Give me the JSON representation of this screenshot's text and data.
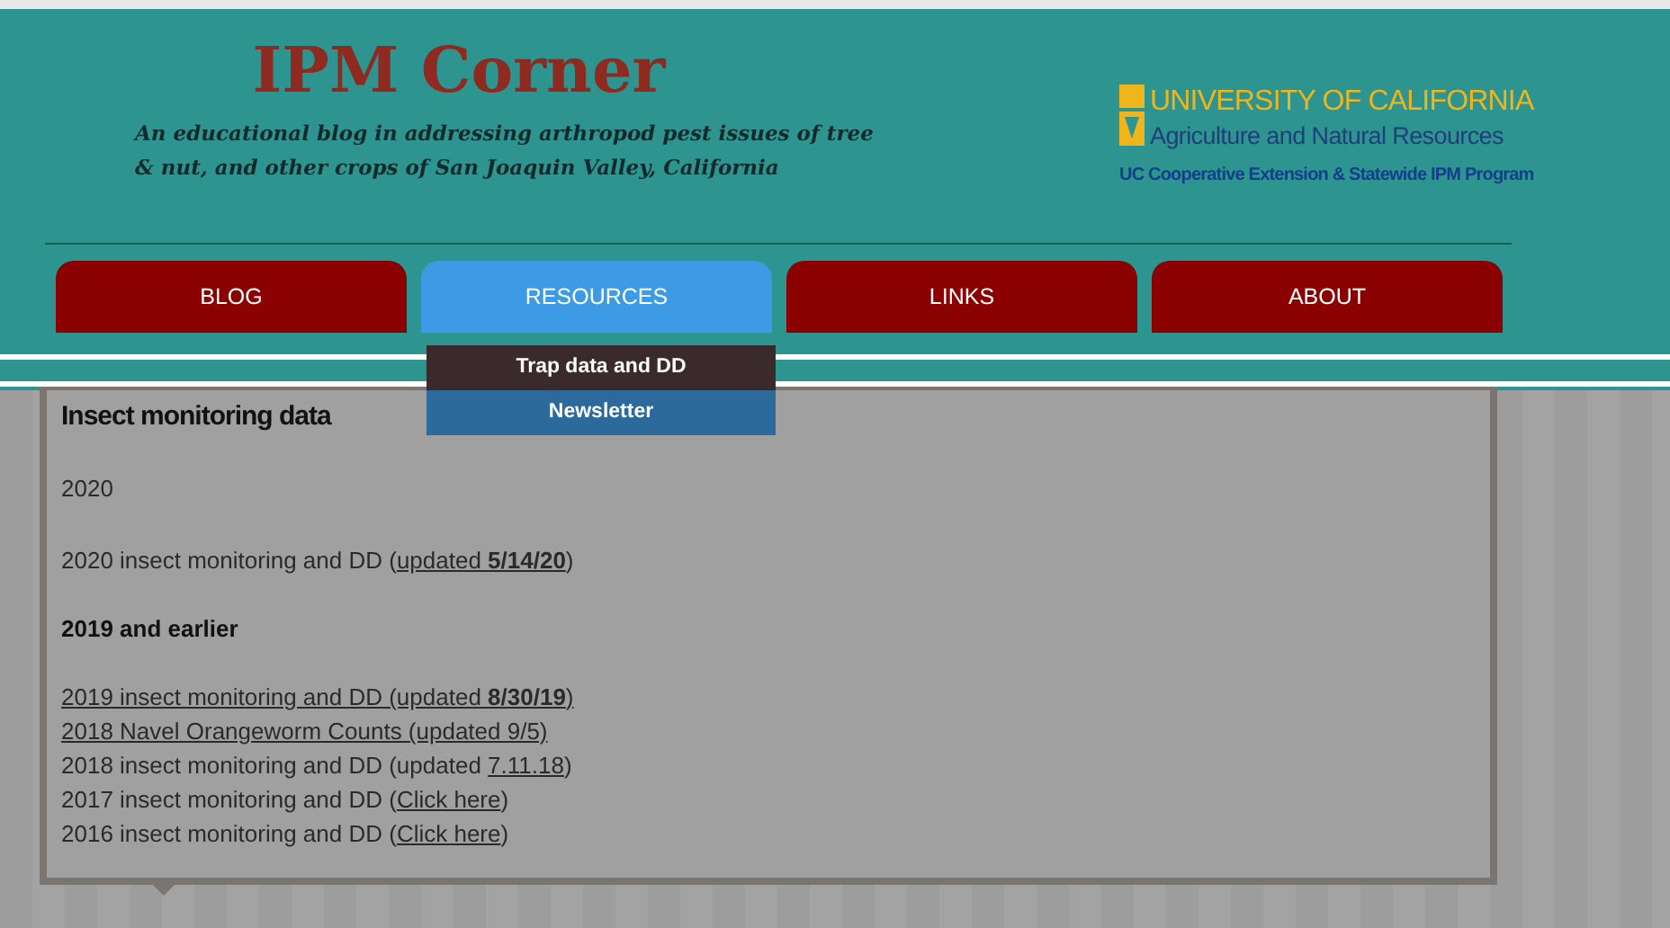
{
  "header": {
    "title": "IPM Corner",
    "tagline": "An educational blog in addressing arthropod pest issues of tree & nut, and other crops of San Joaquin Valley, California",
    "logo": {
      "name": "UNIVERSITY OF CALIFORNIA",
      "division": "Agriculture and Natural Resources",
      "program": "UC Cooperative Extension & Statewide IPM Program"
    }
  },
  "tabs": [
    {
      "label": "BLOG",
      "selected": false
    },
    {
      "label": "RESOURCES",
      "selected": true,
      "menu": [
        {
          "label": "Trap data and DD",
          "selected": true
        },
        {
          "label": "Newsletter",
          "selected": false
        }
      ]
    },
    {
      "label": "LINKS",
      "selected": false
    },
    {
      "label": "ABOUT",
      "selected": false
    }
  ],
  "content": {
    "heading": "Insect monitoring data",
    "blocks": [
      {
        "kind": "para",
        "lines": [
          [
            {
              "kind": "text",
              "text": "2020"
            }
          ]
        ]
      },
      {
        "kind": "para",
        "lines": [
          [
            {
              "kind": "text",
              "text": "2020 insect monitoring and DD ("
            },
            {
              "kind": "link",
              "text": "updated **5/14/20**"
            },
            {
              "kind": "text",
              "text": ")"
            }
          ]
        ]
      },
      {
        "kind": "subhead",
        "text": "2019 and earlier"
      },
      {
        "kind": "para",
        "lines": [
          [
            {
              "kind": "link",
              "text": "2019 insect monitoring and DD (updated **8/30/19**)"
            }
          ],
          [
            {
              "kind": "link",
              "text": "2018 Navel Orangeworm Counts (updated 9/5)"
            }
          ],
          [
            {
              "kind": "text",
              "text": "2018 insect monitoring and DD (updated "
            },
            {
              "kind": "link",
              "text": "7.11.18"
            },
            {
              "kind": "text",
              "text": ")"
            }
          ],
          [
            {
              "kind": "text",
              "text": "2017 insect monitoring and DD ("
            },
            {
              "kind": "link",
              "text": "Click here"
            },
            {
              "kind": "text",
              "text": ")"
            }
          ],
          [
            {
              "kind": "text",
              "text": "2016 insect monitoring and DD ("
            },
            {
              "kind": "link",
              "text": "Click here"
            },
            {
              "kind": "text",
              "text": ")"
            }
          ]
        ]
      }
    ]
  }
}
